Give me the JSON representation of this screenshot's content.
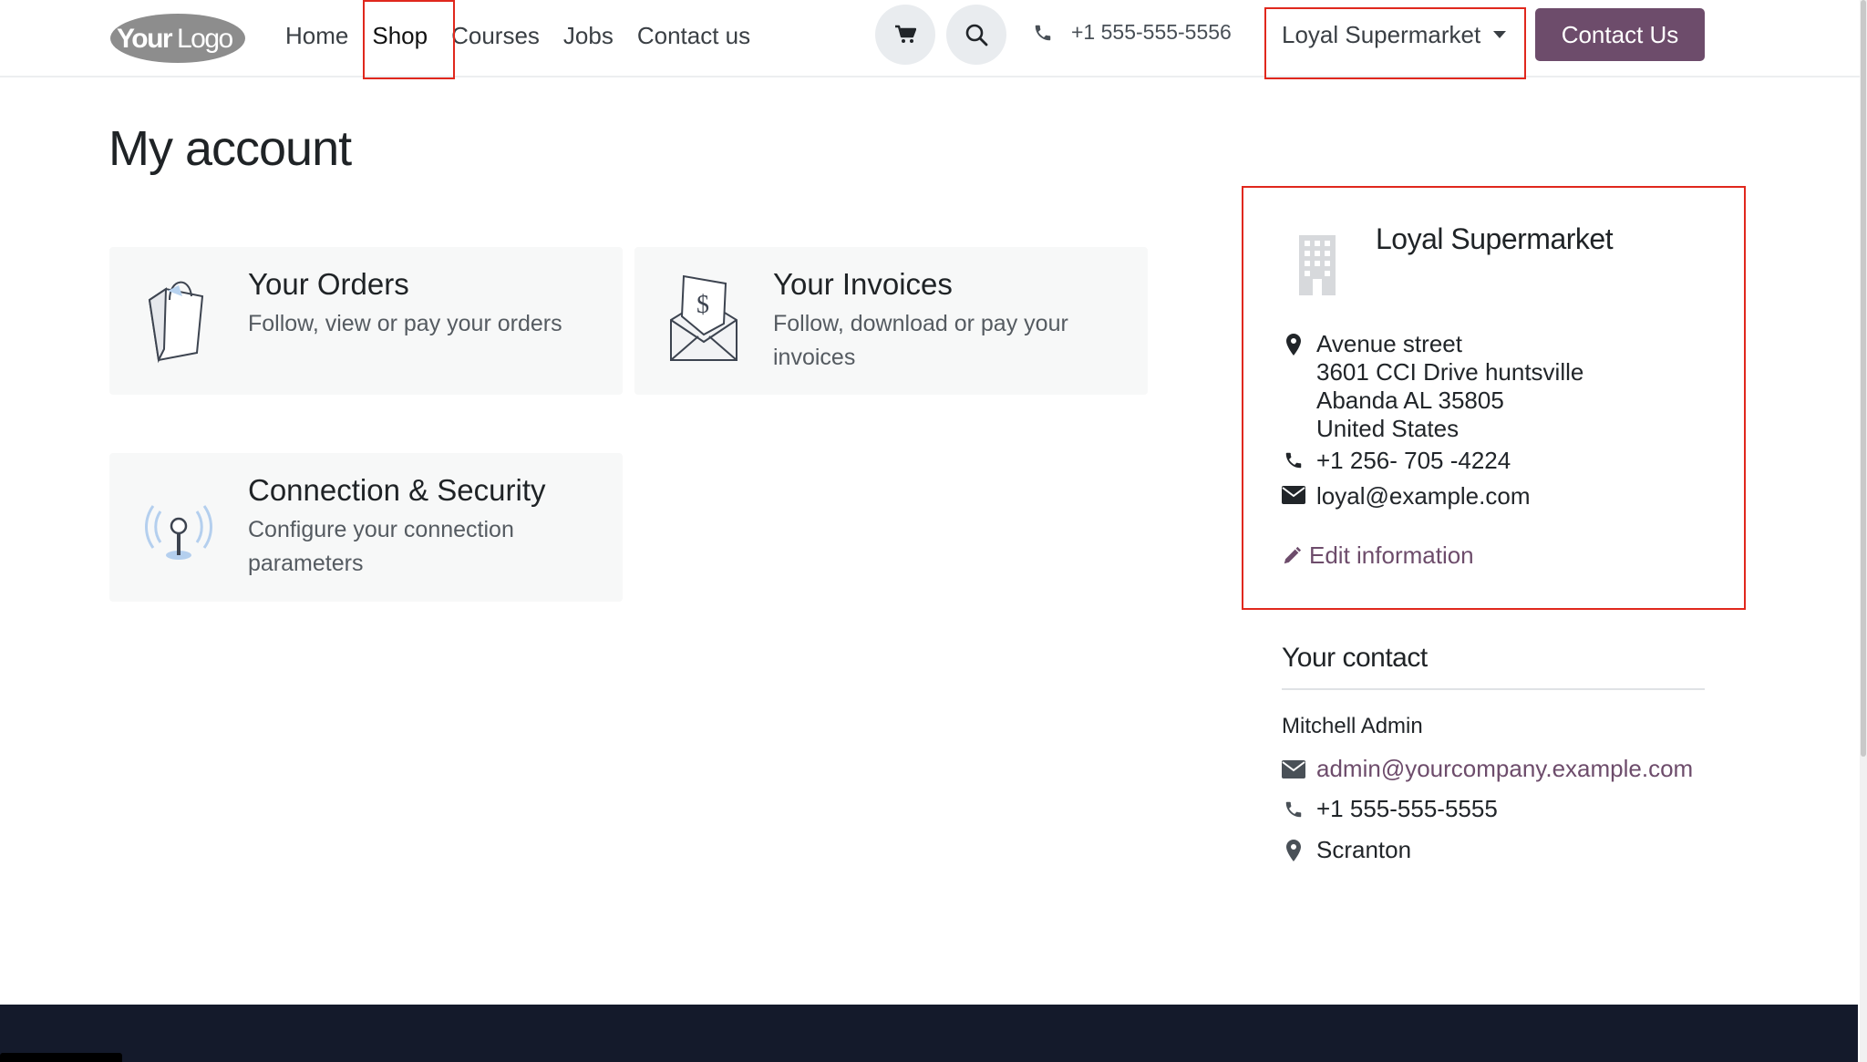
{
  "header": {
    "logo_text": "YourLogo",
    "nav": [
      {
        "label": "Home"
      },
      {
        "label": "Shop"
      },
      {
        "label": "Courses"
      },
      {
        "label": "Jobs"
      },
      {
        "label": "Contact us"
      }
    ],
    "phone": "+1 555-555-5556",
    "company": "Loyal Supermarket",
    "contact_button": "Contact Us"
  },
  "page": {
    "title": "My account"
  },
  "cards": [
    {
      "title": "Your Orders",
      "desc": "Follow, view or pay your orders"
    },
    {
      "title": "Your Invoices",
      "desc": "Follow, download or pay your invoices"
    },
    {
      "title": "Connection & Security",
      "desc": "Configure your connection parameters"
    }
  ],
  "info": {
    "name": "Loyal Supermarket",
    "address": [
      "Avenue street",
      "3601 CCI Drive huntsville",
      "Abanda AL 35805",
      "United States"
    ],
    "phone": "+1 256- 705 -4224",
    "email": "loyal@example.com",
    "edit": "Edit information"
  },
  "contact": {
    "title": "Your contact",
    "name": "Mitchell Admin",
    "email": "admin@yourcompany.example.com",
    "phone": "+1 555-555-5555",
    "city": "Scranton"
  },
  "colors": {
    "brand": "#6d4c6b",
    "highlight": "#e0281d",
    "footer": "#141a2b"
  }
}
